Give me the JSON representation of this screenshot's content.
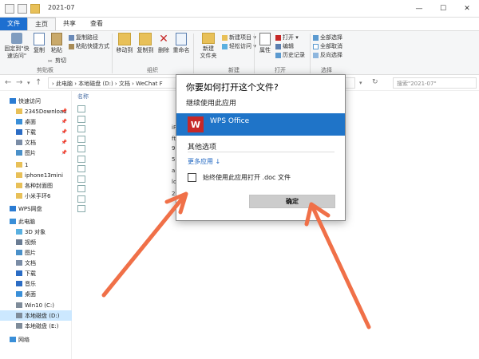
{
  "window": {
    "title": "2021-07",
    "controls": {
      "minimize": "—",
      "maximize": "☐",
      "close": "✕"
    }
  },
  "ribbon_tabs": [
    "文件",
    "主页",
    "共享",
    "查看"
  ],
  "ribbon": {
    "pin_quick_access": "固定到\"快\n速访问\"",
    "copy": "复制",
    "paste": "粘贴",
    "copy_path": "复制路径",
    "paste_shortcut": "粘贴快捷方式",
    "cut": "剪切",
    "clipboard_group": "剪贴板",
    "move_to": "移动到",
    "copy_to": "复制到",
    "delete": "删除",
    "rename": "重命名",
    "organize_group": "组织",
    "new_folder": "新建\n文件夹",
    "new_item": "新建项目 ▾",
    "easy_access": "轻松访问 ▾",
    "new_group": "新建",
    "properties": "属性",
    "open": "打开 ▾",
    "edit": "编辑",
    "history": "历史记录",
    "open_group": "打开",
    "select_all": "全部选择",
    "select_none": "全部取消",
    "invert_selection": "反向选择",
    "select_group": "选择"
  },
  "address": {
    "breadcrumb": "›  此电脑  ›  本地磁盘 (D:)  ›  文档  ›  WeChat F",
    "search_placeholder": "搜索\"2021-07\""
  },
  "nav_pane": [
    {
      "label": "快速访问",
      "icon": "star-icon",
      "color": "#2b7cd3",
      "pinned": false,
      "selected": false
    },
    {
      "label": "2345Download",
      "icon": "folder-icon",
      "color": "#e8c058",
      "pinned": true,
      "selected": false
    },
    {
      "label": "桌面",
      "icon": "desktop-icon",
      "color": "#3a8fd8",
      "pinned": true,
      "selected": false
    },
    {
      "label": "下载",
      "icon": "download-icon",
      "color": "#2b6cc4",
      "pinned": true,
      "selected": false
    },
    {
      "label": "文档",
      "icon": "documents-icon",
      "color": "#7a8ca5",
      "pinned": true,
      "selected": false
    },
    {
      "label": "图片",
      "icon": "pictures-icon",
      "color": "#4a90c9",
      "pinned": true,
      "selected": false
    },
    {
      "label": "1",
      "icon": "folder-icon",
      "color": "#e8c058",
      "pinned": false,
      "selected": false
    },
    {
      "label": "iphone13mini",
      "icon": "folder-icon",
      "color": "#e8c058",
      "pinned": false,
      "selected": false
    },
    {
      "label": "各种封面图",
      "icon": "folder-icon",
      "color": "#e8c058",
      "pinned": false,
      "selected": false
    },
    {
      "label": "小米手环6",
      "icon": "folder-icon",
      "color": "#e8c058",
      "pinned": false,
      "selected": false
    },
    {
      "label": "WPS网盘",
      "icon": "cloud-icon",
      "color": "#2b7cd3",
      "pinned": false,
      "selected": false
    },
    {
      "label": "此电脑",
      "icon": "computer-icon",
      "color": "#3a8fd8",
      "pinned": false,
      "selected": false
    },
    {
      "label": "3D 对象",
      "icon": "3d-objects-icon",
      "color": "#5ab0e0",
      "pinned": false,
      "selected": false
    },
    {
      "label": "视频",
      "icon": "video-icon",
      "color": "#6a7c93",
      "pinned": false,
      "selected": false
    },
    {
      "label": "图片",
      "icon": "pictures-icon",
      "color": "#4a90c9",
      "pinned": false,
      "selected": false
    },
    {
      "label": "文档",
      "icon": "documents-icon",
      "color": "#7a8ca5",
      "pinned": false,
      "selected": false
    },
    {
      "label": "下载",
      "icon": "download-icon",
      "color": "#2b6cc4",
      "pinned": false,
      "selected": false
    },
    {
      "label": "音乐",
      "icon": "music-icon",
      "color": "#2b6cc4",
      "pinned": false,
      "selected": false
    },
    {
      "label": "桌面",
      "icon": "desktop-icon",
      "color": "#3a8fd8",
      "pinned": false,
      "selected": false
    },
    {
      "label": "Win10 (C:)",
      "icon": "drive-icon",
      "color": "#7f8c9a",
      "pinned": false,
      "selected": false
    },
    {
      "label": "本地磁盘 (D:)",
      "icon": "drive-icon",
      "color": "#7f8c9a",
      "pinned": false,
      "selected": true
    },
    {
      "label": "本地磁盘 (E:)",
      "icon": "drive-icon",
      "color": "#7f8c9a",
      "pinned": false,
      "selected": false
    },
    {
      "label": "网络",
      "icon": "network-icon",
      "color": "#3a8fd8",
      "pinned": false,
      "selected": false
    }
  ],
  "file_list": {
    "column_header": "名称",
    "fragments": [
      "iF",
      "ft",
      "9",
      "5",
      "a",
      "lo",
      "2"
    ]
  },
  "dialog": {
    "title": "你要如何打开这个文件?",
    "continue_label": "继续使用此应用",
    "selected_app": "WPS Office",
    "selected_app_logo": "W",
    "other_options": "其他选项",
    "more_apps": "更多应用 ↓",
    "always_use_label": "始终使用此应用打开 .doc 文件",
    "always_use_checked": false,
    "ok_button": "确定"
  },
  "colors": {
    "accent": "#1f74c8",
    "arrow": "#f07048",
    "wps_red": "#c62828"
  }
}
